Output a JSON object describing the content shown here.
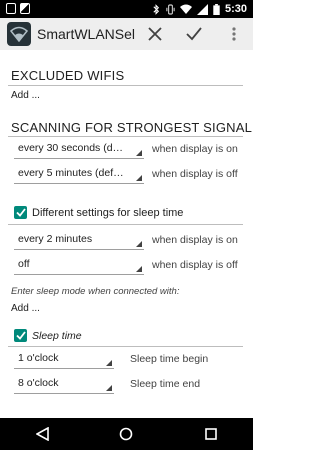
{
  "status_bar": {
    "time": "5:30",
    "icons": [
      "bluetooth-icon",
      "vibrate-icon",
      "wifi-icon",
      "signal-icon",
      "battery-icon"
    ]
  },
  "action_bar": {
    "title": "SmartWLANSel…",
    "actions": [
      "close-icon",
      "check-icon",
      "overflow-menu-icon"
    ]
  },
  "excluded": {
    "header": "EXCLUDED WIFIS",
    "add_label": "Add ..."
  },
  "scanning": {
    "header": "SCANNING FOR STRONGEST SIGNAL",
    "row1": {
      "value": "every 30 seconds (d…",
      "label": "when display is on"
    },
    "row2": {
      "value": "every 5 minutes (def…",
      "label": "when display is off"
    }
  },
  "sleep_settings": {
    "checkbox_label": "Different settings for sleep time",
    "checked": true,
    "row1": {
      "value": "every 2 minutes",
      "label": "when display is on"
    },
    "row2": {
      "value": "off",
      "label": "when display is off"
    }
  },
  "sleep_mode": {
    "hint": "Enter sleep mode when connected with:",
    "add_label": "Add ..."
  },
  "sleep_time": {
    "checkbox_label": "Sleep time",
    "checked": true,
    "begin": {
      "value": "1 o'clock",
      "label": "Sleep time begin"
    },
    "end": {
      "value": "8 o'clock",
      "label": "Sleep time end"
    }
  },
  "nav_bar": {
    "buttons": [
      "back-icon",
      "home-icon",
      "recents-icon"
    ]
  },
  "colors": {
    "accent": "#00897b",
    "action_bar": "#eeeeee",
    "status_bar": "#000000"
  }
}
